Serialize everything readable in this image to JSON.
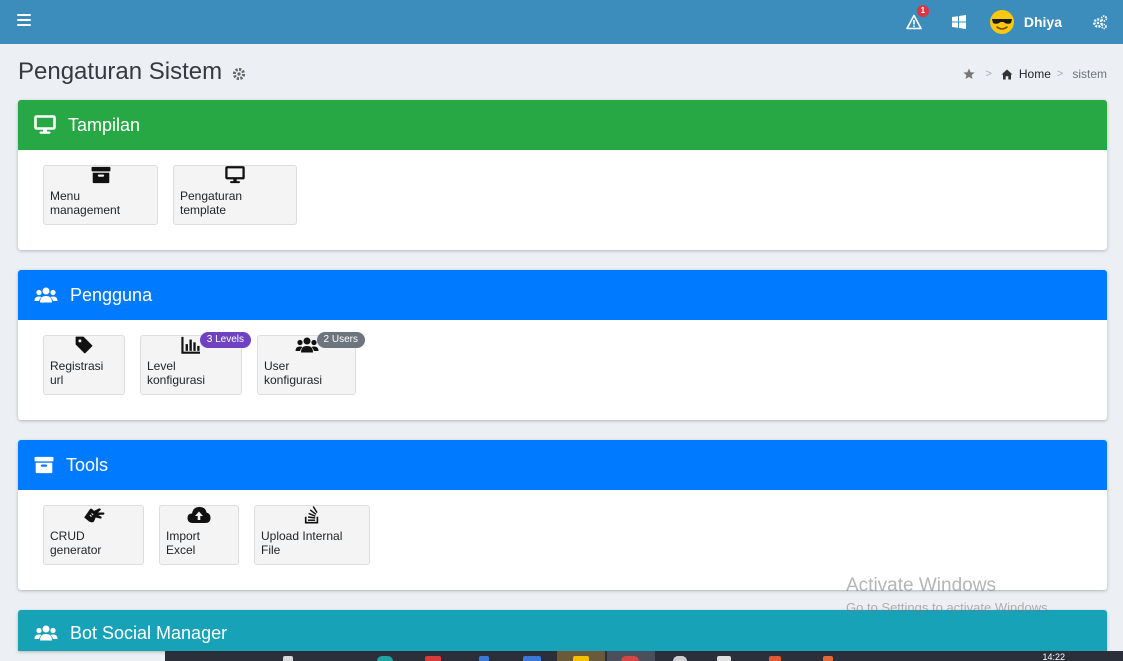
{
  "topbar": {
    "alert_count": "1",
    "user_name": "Dhiya"
  },
  "page": {
    "title": "Pengaturan Sistem"
  },
  "breadcrumb": {
    "sep": ">",
    "home": "Home",
    "current": "sistem"
  },
  "sections": [
    {
      "title": "Tampilan",
      "color": "#28a745",
      "tiles": [
        {
          "label": "Menu management",
          "icon": "archive-icon"
        },
        {
          "label": "Pengaturan template",
          "icon": "monitor-icon"
        }
      ]
    },
    {
      "title": "Pengguna",
      "color": "#007bff",
      "tiles": [
        {
          "label": "Registrasi url",
          "icon": "tag-icon"
        },
        {
          "label": "Level konfigurasi",
          "icon": "chart-bar-icon",
          "badge": "3 Levels",
          "badge_color": "#6f42c1"
        },
        {
          "label": "User konfigurasi",
          "icon": "users-icon",
          "badge": "2 Users",
          "badge_color": "#6c757d"
        }
      ]
    },
    {
      "title": "Tools",
      "color": "#007bff",
      "tiles": [
        {
          "label": "CRUD generator",
          "icon": "sign-language-icon"
        },
        {
          "label": "Import Excel",
          "icon": "cloud-upload-icon"
        },
        {
          "label": "Upload Internal File",
          "icon": "stack-overflow-icon"
        }
      ]
    },
    {
      "title": "Bot Social Manager",
      "color": "#17a2b8"
    }
  ],
  "watermark": {
    "title": "Activate Windows",
    "subtitle": "Go to Settings to activate Windows."
  },
  "taskbar": {
    "clock": "14:22"
  }
}
